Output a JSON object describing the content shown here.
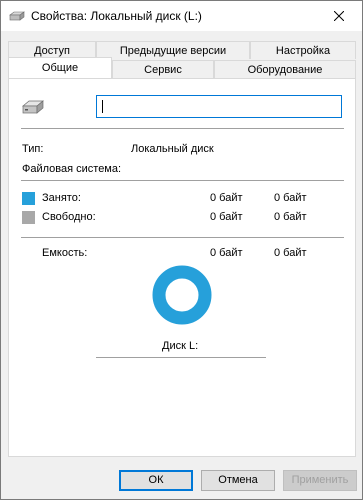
{
  "window": {
    "title": "Свойства: Локальный диск (L:)",
    "icon": "drive-icon",
    "close_icon": "close-icon"
  },
  "tabs": {
    "row_back": [
      {
        "label": "Доступ"
      },
      {
        "label": "Предыдущие версии"
      },
      {
        "label": "Настройка"
      }
    ],
    "row_front": [
      {
        "label": "Общие",
        "active": true
      },
      {
        "label": "Сервис"
      },
      {
        "label": "Оборудование"
      }
    ]
  },
  "general": {
    "drive_name_value": "",
    "type_label": "Тип:",
    "type_value": "Локальный диск",
    "fs_label": "Файловая система:",
    "fs_value": "",
    "used": {
      "label": "Занято:",
      "bytes": "0 байт",
      "size": "0 байт",
      "color": "#26a0da"
    },
    "free": {
      "label": "Свободно:",
      "bytes": "0 байт",
      "size": "0 байт",
      "color": "#a8a8a8"
    },
    "capacity": {
      "label": "Емкость:",
      "bytes": "0 байт",
      "size": "0 байт"
    },
    "disk_label": "Диск L:",
    "chart_color": "#26a0da"
  },
  "buttons": {
    "ok": "ОК",
    "cancel": "Отмена",
    "apply": "Применить"
  }
}
